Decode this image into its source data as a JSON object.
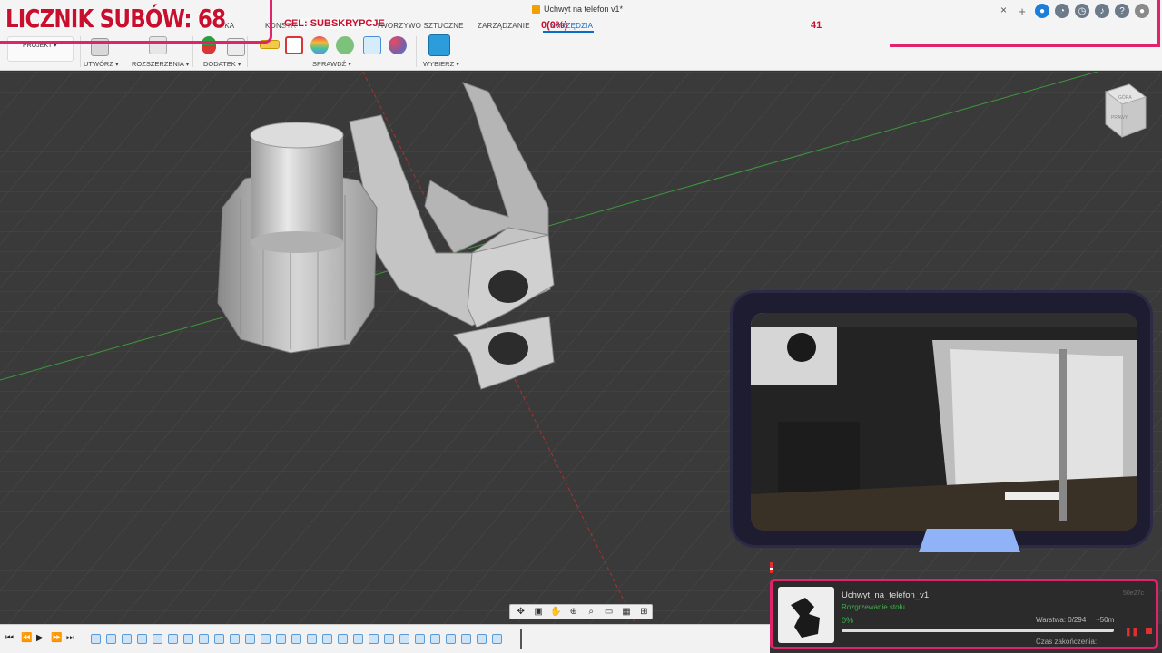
{
  "window": {
    "title": "Uchwyt na telefon v1*",
    "close_label": "×"
  },
  "ribbon": {
    "tabs": [
      "KONSTR",
      "TWORZYWO SZTUCZNE",
      "ZARZĄDZANIE",
      "NARZĘDZIA"
    ],
    "tab_hidden_prefix": "...KA",
    "active_tab": "NARZĘDZIA",
    "project_label": "PROJEKT ▾",
    "groups": {
      "create": "UTWÓRZ ▾",
      "extensions": "ROZSZERZENIA ▾",
      "addon": "DODATEK ▾",
      "inspect": "SPRAWDŹ ▾",
      "select": "WYBIERZ ▾"
    }
  },
  "overlay": {
    "sub_counter": "LICZNIK SUBÓW: 68",
    "goal": "CEL: SUBSKRYPCJE",
    "goal_current": "41",
    "goal_percent": "0(0%)"
  },
  "print_job": {
    "name": "Uchwyt_na_telefon_v1",
    "status": "Rozgrzewanie stołu",
    "percent": "0%",
    "progress": 0,
    "layer": "Warstwa: 0/294",
    "remaining": "~50m",
    "end_label": "Czas zakończenia:",
    "job_id": "50e27c"
  },
  "nav_toolbar": {
    "icons": [
      "orbit-icon",
      "look-at-icon",
      "pan-icon",
      "zoom-icon",
      "fit-icon",
      "display-icon",
      "grid-icon",
      "viewports-icon"
    ]
  },
  "timeline": {
    "item_count": 27
  },
  "view_cube": {
    "top_label": "GÓRA",
    "front_label": "PRAWY"
  },
  "colors": {
    "accent": "#0a6cc4",
    "overlay_pink": "#e0246c",
    "overlay_red": "#c8102e",
    "status_green": "#3bb34a",
    "viewport_bg": "#3a3a3a"
  }
}
